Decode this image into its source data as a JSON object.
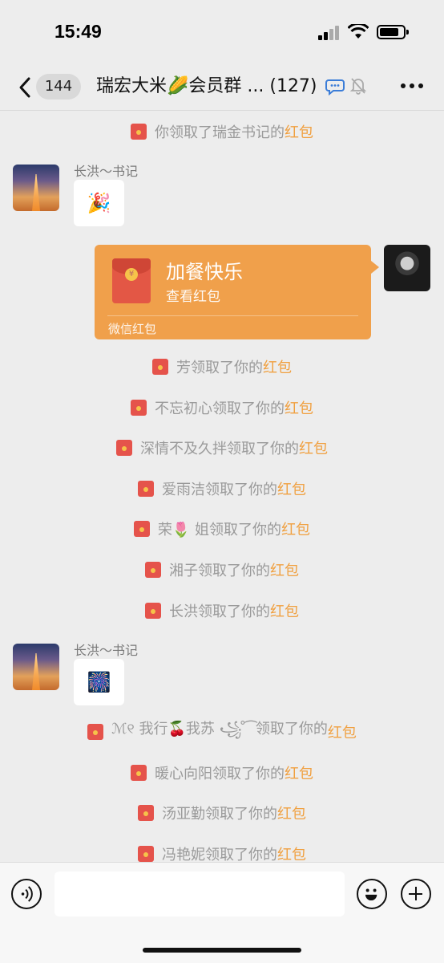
{
  "status_bar": {
    "time": "15:49"
  },
  "header": {
    "unread_count": "144",
    "title": "瑞宏大米🌽会员群 ... (127)"
  },
  "messages": {
    "sys_top": {
      "prefix": "你领取了瑞金书记的",
      "highlight": "红包"
    },
    "sender1_name": "长洪～书记",
    "sender1_emoji": "🎉",
    "red_packet": {
      "title": "加餐快乐",
      "subtitle": "查看红包",
      "footer": "微信红包",
      "coin": "¥"
    },
    "claims": [
      {
        "prefix": "芳领取了你的",
        "highlight": "红包"
      },
      {
        "prefix": "不忘初心领取了你的",
        "highlight": "红包"
      },
      {
        "prefix": "深情不及久拌领取了你的",
        "highlight": "红包"
      },
      {
        "prefix": "爱雨洁领取了你的",
        "highlight": "红包"
      },
      {
        "prefix": "荣🌷 姐领取了你的",
        "highlight": "红包"
      },
      {
        "prefix": "湘子领取了你的",
        "highlight": "红包"
      },
      {
        "prefix": "长洪领取了你的",
        "highlight": "红包"
      }
    ],
    "sender2_name": "长洪～书记",
    "sender2_emoji": "🎆",
    "claims2": [
      {
        "prefix": "ℳ୧ 我行🍒我苏 ꧁ ̊ ͡ 领取了你的",
        "highlight": "红包"
      },
      {
        "prefix": "暖心向阳领取了你的",
        "highlight": "红包"
      },
      {
        "prefix": "汤亚勤领取了你的",
        "highlight": "红包"
      },
      {
        "prefix": "冯艳妮领取了你的",
        "highlight": "红包"
      }
    ]
  },
  "input_bar": {
    "placeholder": ""
  }
}
